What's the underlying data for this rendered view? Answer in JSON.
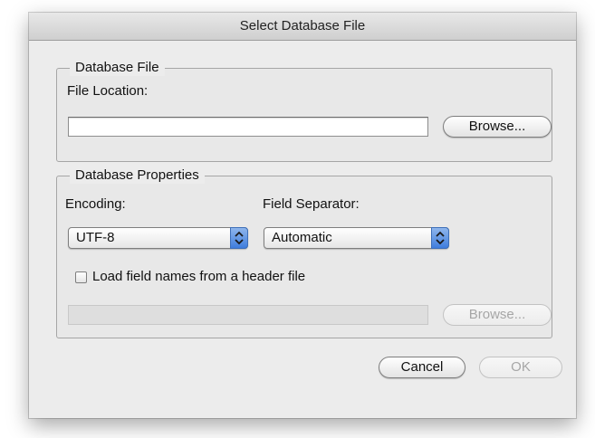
{
  "dialog": {
    "title": "Select Database File"
  },
  "database_file": {
    "legend": "Database File",
    "file_location_label": "File Location:",
    "file_location_value": "",
    "browse_label": "Browse..."
  },
  "database_properties": {
    "legend": "Database Properties",
    "encoding_label": "Encoding:",
    "encoding_value": "UTF-8",
    "field_separator_label": "Field Separator:",
    "field_separator_value": "Automatic",
    "header_checkbox_label": "Load field names from a header file",
    "header_checkbox_checked": false,
    "header_file_value": "",
    "header_browse_label": "Browse..."
  },
  "actions": {
    "cancel_label": "Cancel",
    "ok_label": "OK"
  },
  "colors": {
    "popup_accent": "#3f7ddd",
    "dialog_background": "#ececec"
  },
  "icons": {
    "popup_arrows": "up-down-chevron-icon"
  }
}
